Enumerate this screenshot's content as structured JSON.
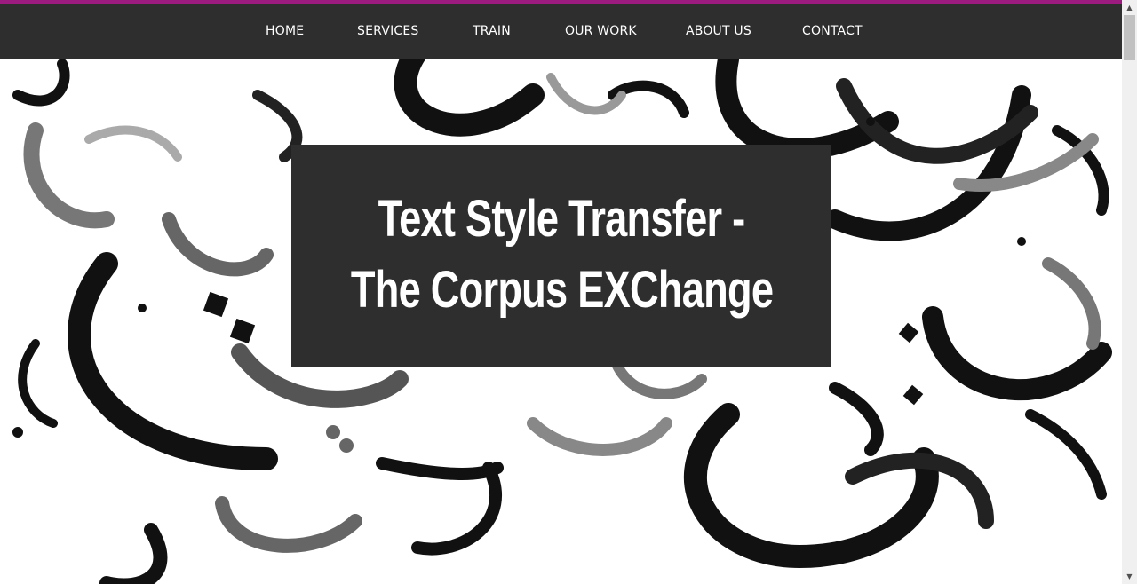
{
  "colors": {
    "accent": "#9b1b7e",
    "navbar_bg": "#2e2e2e",
    "nav_text": "#ffffff",
    "title_box_bg": "#2e2e2e",
    "title_text": "#ffffff"
  },
  "nav": {
    "items": [
      {
        "label": "HOME"
      },
      {
        "label": "SERVICES"
      },
      {
        "label": "TRAIN"
      },
      {
        "label": "OUR WORK"
      },
      {
        "label": "ABOUT US"
      },
      {
        "label": "CONTACT"
      }
    ]
  },
  "hero": {
    "background": "arabic-calligraphy-pattern",
    "title_line1": "Text Style Transfer -",
    "title_line2": "The Corpus EXChange"
  },
  "scrollbar": {
    "up_icon": "triangle-up-icon",
    "down_icon": "triangle-down-icon"
  }
}
